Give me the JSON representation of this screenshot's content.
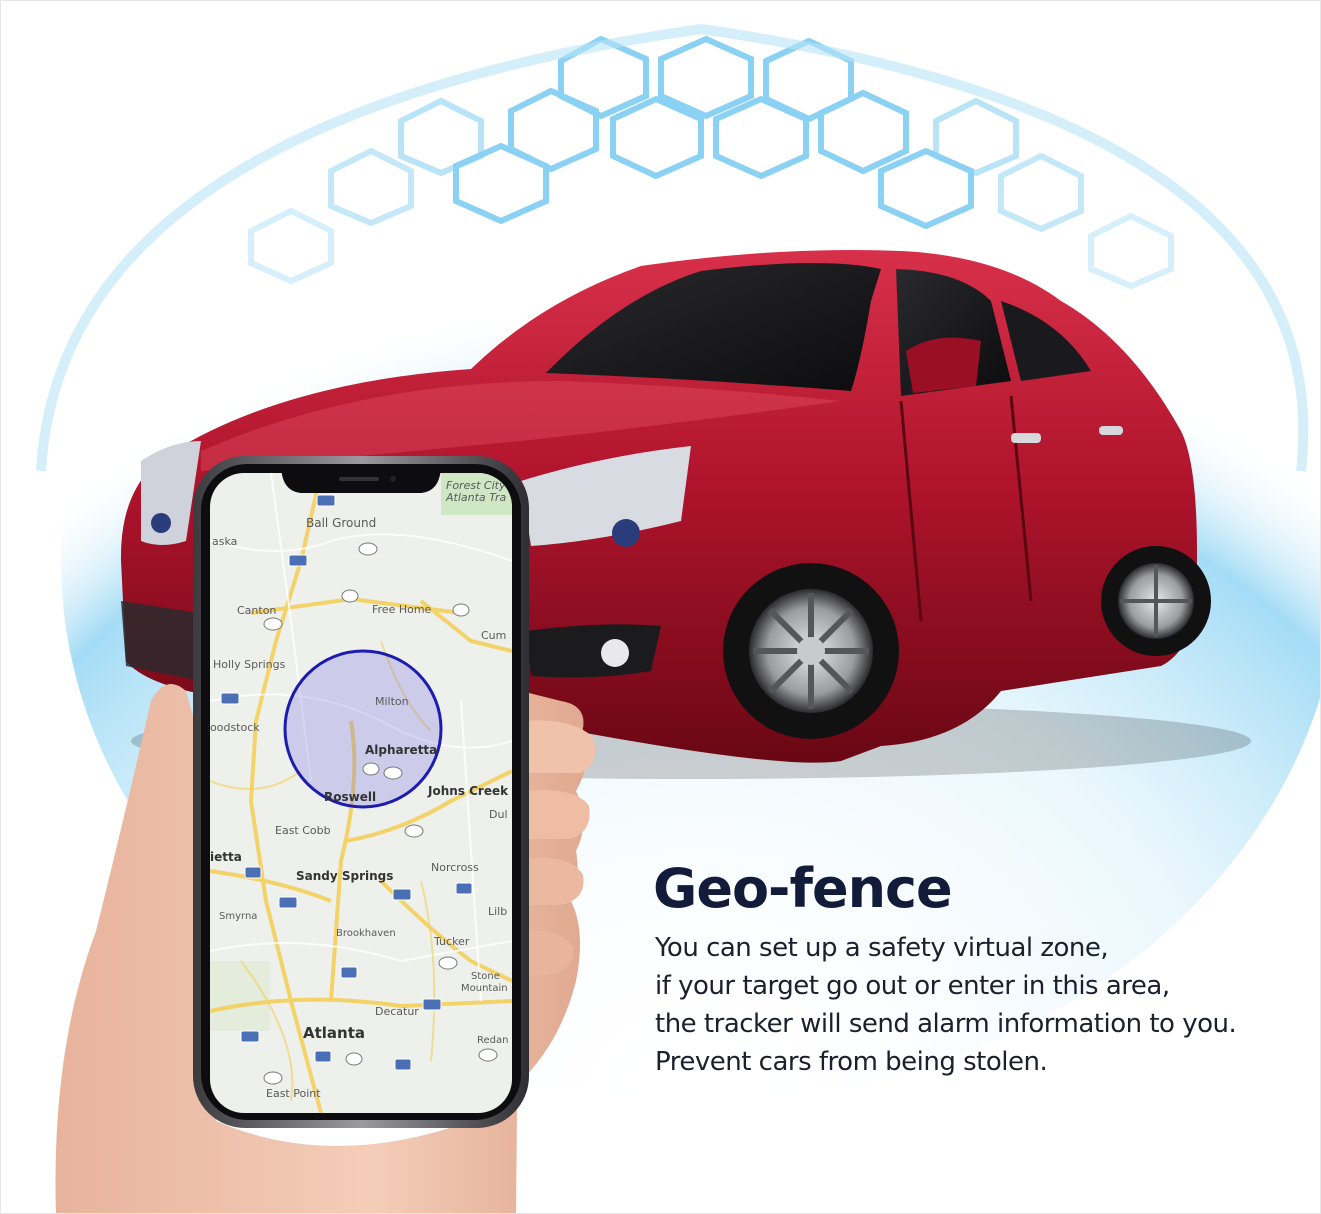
{
  "feature": {
    "title": "Geo-fence",
    "description_lines": [
      "You can set up a safety virtual zone,",
      "if your target go out or enter in this area,",
      "the tracker will send alarm information to you.",
      "Prevent cars from being stolen."
    ]
  },
  "map": {
    "places": {
      "ball_ground": "Ball Ground",
      "canton": "Canton",
      "free_home": "Free Home",
      "holly_springs": "Holly Springs",
      "woodstock": "oodstock",
      "milton": "Milton",
      "alpharetta": "Alpharetta",
      "roswell": "Roswell",
      "johns_creek": "Johns Creek",
      "east_cobb": "East Cobb",
      "marietta": "ietta",
      "sandy_springs": "Sandy Springs",
      "norcross": "Norcross",
      "smyrna": "Smyrna",
      "brookhaven": "Brookhaven",
      "tucker": "Tucker",
      "stone_mountain": "Stone",
      "stone_mountain_2": "Mountain",
      "decatur": "Decatur",
      "atlanta": "Atlanta",
      "east_point": "East Point",
      "redan": "Redan",
      "dawson_forest": "Forest City",
      "dawson_forest_2": "Atlanta Tra",
      "aska": "aska",
      "cumming": "Cum",
      "duluth": "Dul",
      "lilburn": "Lilb"
    },
    "route_shields": [
      "575",
      "372",
      "575",
      "20",
      "20",
      "140",
      "575",
      "9",
      "19",
      "140",
      "75",
      "285",
      "285",
      "85",
      "78",
      "285",
      "285",
      "85",
      "23",
      "20",
      "154",
      "278"
    ],
    "geofence_color": "#1c1cb0",
    "geofence_fill": "rgba(120,110,230,0.28)"
  },
  "colors": {
    "car_body": "#b0142c",
    "title_color": "#121c3a",
    "dome_color": "#6ec6f0"
  }
}
